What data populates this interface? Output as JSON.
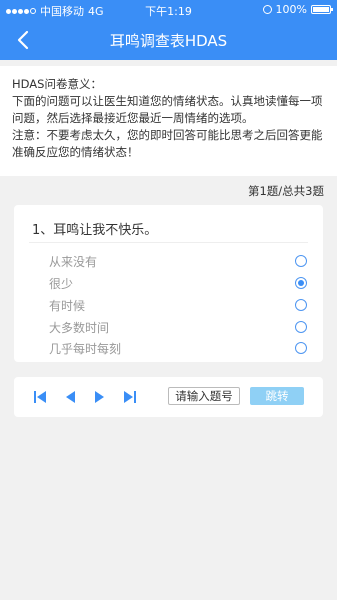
{
  "status": {
    "carrier": "中国移动",
    "network": "4G",
    "time": "下午1:19",
    "battery": "100%"
  },
  "nav": {
    "back_icon": "chevron-left-icon",
    "title": "耳鸣调查表HDAS"
  },
  "intro": {
    "line1": "HDAS问卷意义：",
    "line2": "下面的问题可以让医生知道您的情绪状态。认真地读懂每一项问题，然后选择最接近您最近一周情绪的选项。",
    "line3": "注意：不要考虑太久，您的即时回答可能比思考之后回答更能准确反应您的情绪状态！"
  },
  "progress": "第1题/总共3题",
  "question": {
    "text": "1、耳鸣让我不快乐。",
    "options": [
      {
        "label": "从来没有",
        "checked": false
      },
      {
        "label": "很少",
        "checked": true
      },
      {
        "label": "有时候",
        "checked": false
      },
      {
        "label": "大多数时间",
        "checked": false
      },
      {
        "label": "几乎每时每刻",
        "checked": false
      }
    ]
  },
  "pager": {
    "first_icon": "first-page-icon",
    "prev_icon": "previous-icon",
    "next_icon": "next-icon",
    "last_icon": "last-page-icon",
    "input_placeholder": "请输入题号",
    "jump_label": "跳转"
  },
  "colors": {
    "primary": "#3a8ef6",
    "jump_button": "#8fd0f5"
  }
}
